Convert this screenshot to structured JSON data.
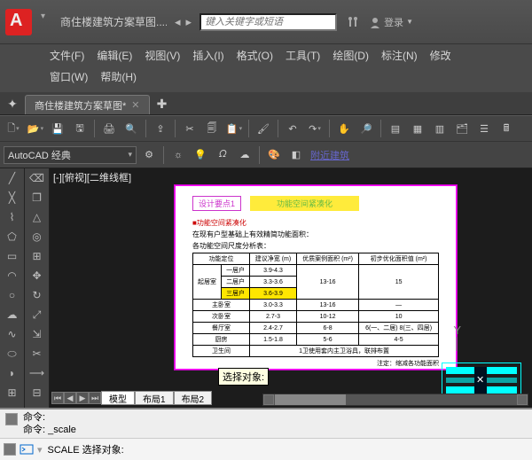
{
  "titlebar": {
    "filename": "商住楼建筑方案草图....",
    "search_placeholder": "键入关键字或短语",
    "login": "登录"
  },
  "menu": {
    "file": "文件(F)",
    "edit": "编辑(E)",
    "view": "视图(V)",
    "insert": "插入(I)",
    "format": "格式(O)",
    "tools": "工具(T)",
    "draw": "绘图(D)",
    "dim": "标注(N)",
    "modify": "修改",
    "window": "窗口(W)",
    "help": "帮助(H)"
  },
  "filetab": {
    "name": "商住楼建筑方案草图*"
  },
  "workspace": {
    "selected": "AutoCAD 经典",
    "link": "附近建筑"
  },
  "viewport": {
    "label": "[-][俯视][二维线框]"
  },
  "sheet": {
    "keypoint": "设计要点1",
    "banner": "功能空间紧凑化",
    "red_sub": "■功能空间紧凑化",
    "black_sub": "在现有户型基础上有效精简功能面积：",
    "tbl_title": "各功能空间尺度分析表：",
    "headers": [
      "功能定位",
      "建议净宽 (m)",
      "优质案例面积 (m²)",
      "初步优化面积值 (m²)"
    ],
    "rows": [
      [
        "起居室",
        "一居户",
        "3.9-4.3",
        "",
        ""
      ],
      [
        "起居室",
        "二居户",
        "3.3-3.6",
        "13-16",
        "15"
      ],
      [
        "起居室",
        "三居户",
        "3.6-3.9",
        "",
        ""
      ],
      [
        "主卧室",
        "",
        "3.0-3.3",
        "13-16",
        "—"
      ],
      [
        "次卧室",
        "",
        "2.7-3",
        "10-12",
        "10"
      ],
      [
        "餐厅室",
        "",
        "2.4-2.7",
        "6-8",
        "6(一、二居) 8(三、四居)"
      ],
      [
        "厨房",
        "",
        "1.5-1.8",
        "5-6",
        "4-5"
      ],
      [
        "卫生间",
        "1卫使用套内主卫浴具，联排布置",
        "",
        "",
        ""
      ]
    ],
    "footnote": "注定：缩减各功能面积"
  },
  "tooltip": "选择对象:",
  "vp_tabs": {
    "model": "模型",
    "layout1": "布局1",
    "layout2": "布局2"
  },
  "cmd": {
    "hist1": "命令:",
    "hist2": "命令: _scale",
    "line": "SCALE 选择对象:"
  }
}
